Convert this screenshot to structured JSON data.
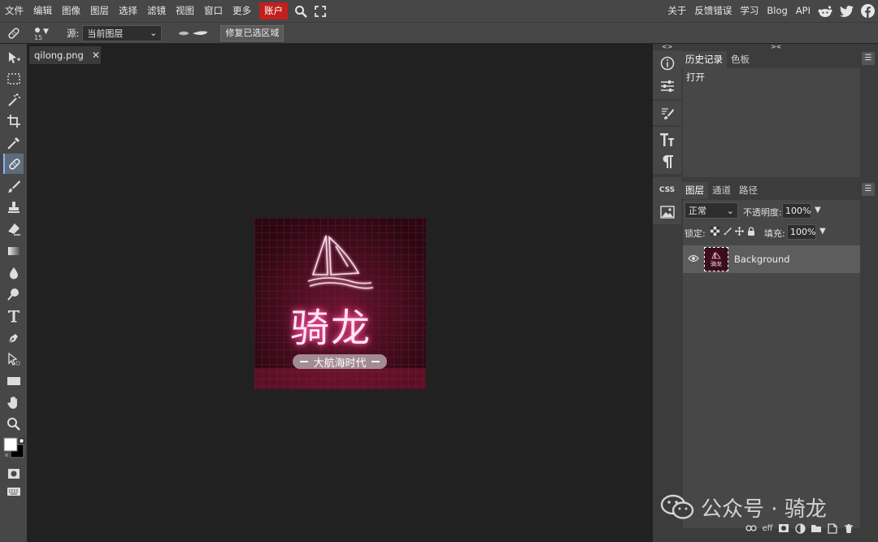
{
  "menubar": {
    "items": [
      "文件",
      "编辑",
      "图像",
      "图层",
      "选择",
      "滤镜",
      "视图",
      "窗口",
      "更多"
    ],
    "account": "账户",
    "right_items": [
      "关于",
      "反馈错误",
      "学习",
      "Blog",
      "API"
    ],
    "account_color": "#c21f1f"
  },
  "options": {
    "brush_size": "15",
    "source_label": "源:",
    "source_value": "当前图层",
    "repair_button": "修复已选区域"
  },
  "document": {
    "tab_name": "qilong.png",
    "image": {
      "title": "骑龙",
      "subtitle": "大航海时代",
      "bg_color": "#3a0e1c",
      "neon_color": "#ff7fbf"
    }
  },
  "side_icons": [
    "info-icon",
    "sliders-icon",
    "brush-settings-icon",
    "character-icon",
    "paragraph-icon",
    "css-icon",
    "image-icon"
  ],
  "history_panel": {
    "tabs": [
      "历史记录",
      "色板"
    ],
    "items": [
      "打开"
    ]
  },
  "layers_panel": {
    "tabs": [
      "图层",
      "通道",
      "路径"
    ],
    "blend_mode": "正常",
    "opacity_label": "不透明度:",
    "opacity_value": "100%",
    "lock_label": "锁定:",
    "fill_label": "填充:",
    "fill_value": "100%",
    "layers": [
      {
        "name": "Background",
        "visible": true
      }
    ],
    "footer_icons": [
      "link-icon",
      "effects-icon",
      "mask-icon",
      "adjustment-icon",
      "folder-icon",
      "new-layer-icon",
      "trash-icon"
    ],
    "footer_effects_label": "eff"
  },
  "watermark": "公众号 · 骑龙"
}
